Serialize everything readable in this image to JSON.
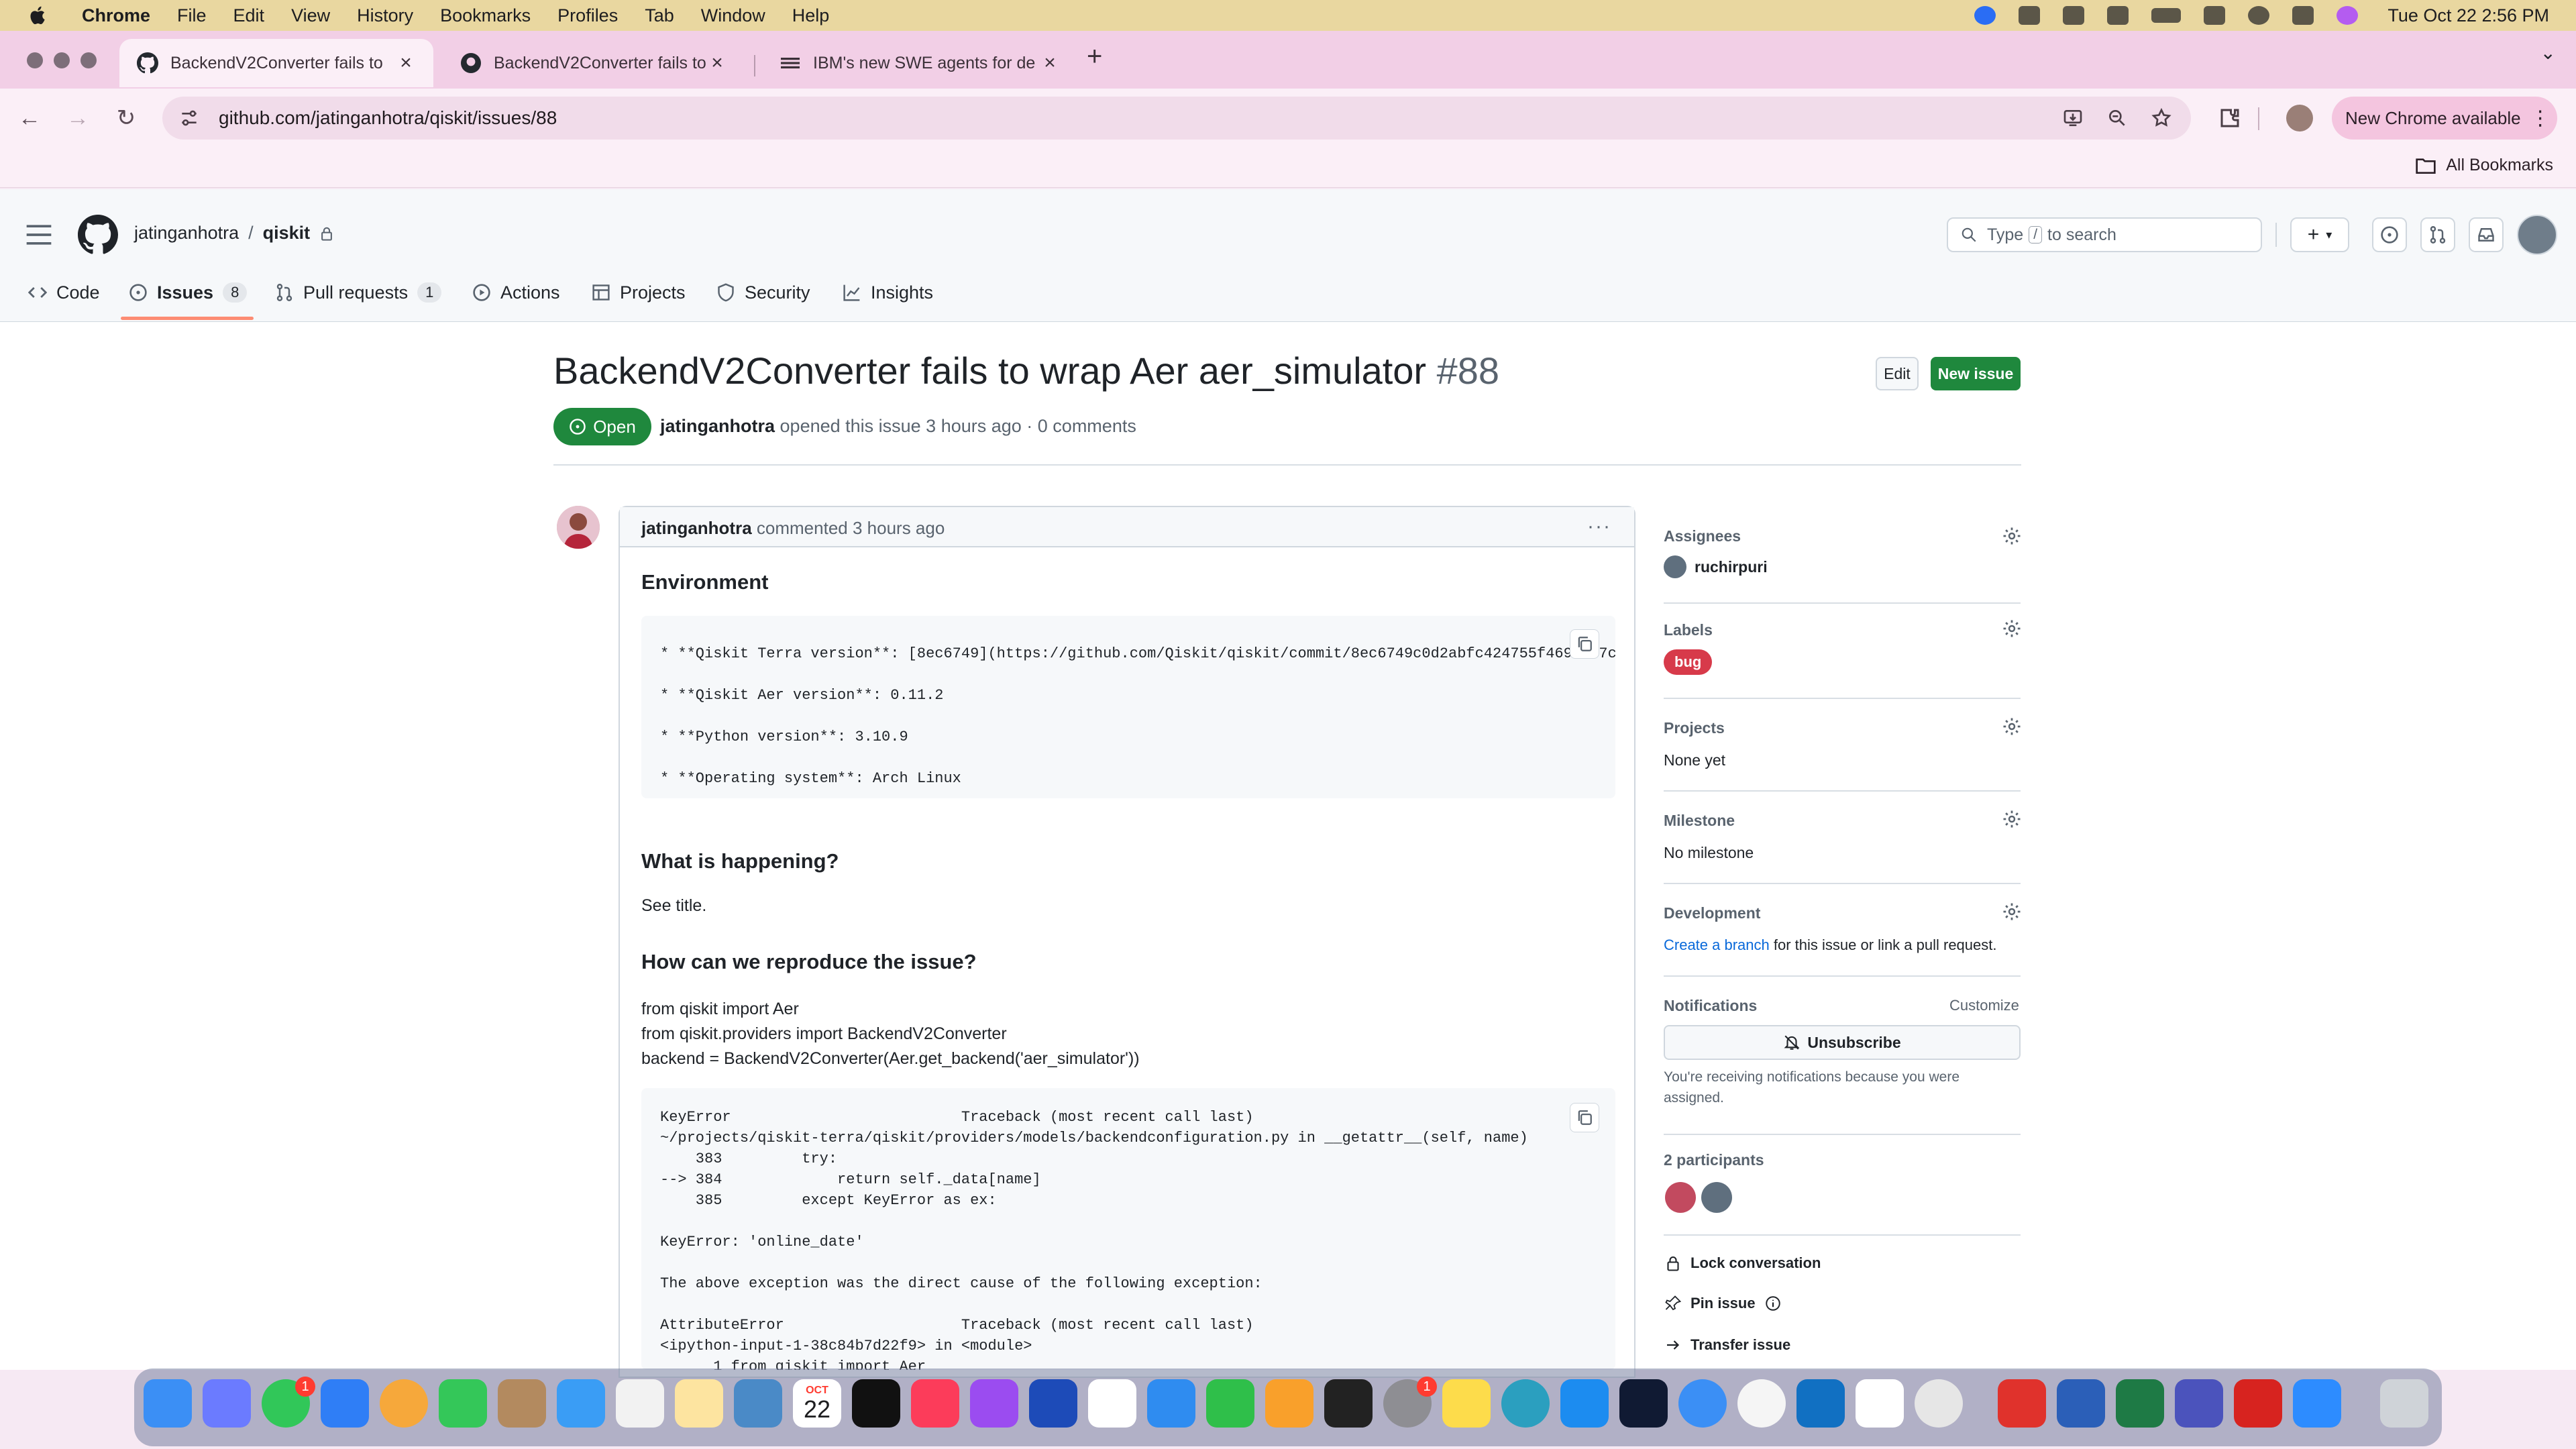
{
  "menubar": {
    "app": "Chrome",
    "items": [
      "File",
      "Edit",
      "View",
      "History",
      "Bookmarks",
      "Profiles",
      "Tab",
      "Window",
      "Help"
    ],
    "clock": "Tue Oct 22  2:56 PM"
  },
  "browser": {
    "tabs": [
      {
        "title": "BackendV2Converter fails to",
        "icon": "github-icon"
      },
      {
        "title": "BackendV2Converter fails to",
        "icon": "github-icon"
      },
      {
        "title": "IBM's new SWE agents for de",
        "icon": "ibm-icon"
      }
    ],
    "url": "github.com/jatinganhotra/qiskit/issues/88",
    "new_chrome": "New Chrome available",
    "all_bookmarks": "All Bookmarks"
  },
  "github": {
    "owner": "jatinganhotra",
    "sep": "/",
    "repo": "qiskit",
    "search_prefix": "Type",
    "search_key": "/",
    "search_suffix": "to search",
    "tabs": [
      {
        "label": "Code",
        "count": ""
      },
      {
        "label": "Issues",
        "count": "8"
      },
      {
        "label": "Pull requests",
        "count": "1"
      },
      {
        "label": "Actions",
        "count": ""
      },
      {
        "label": "Projects",
        "count": ""
      },
      {
        "label": "Security",
        "count": ""
      },
      {
        "label": "Insights",
        "count": ""
      }
    ]
  },
  "issue": {
    "title": "BackendV2Converter fails to wrap Aer aer_simulator",
    "number": "#88",
    "edit": "Edit",
    "new_issue": "New issue",
    "state": "Open",
    "author": "jatinganhotra",
    "opened_text": "opened this issue 3 hours ago · 0 comments"
  },
  "comment": {
    "author": "jatinganhotra",
    "time_text": "commented 3 hours ago",
    "env_heading": "Environment",
    "env_lines": [
      "* **Qiskit Terra version**: [8ec6749](https://github.com/Qiskit/qiskit/commit/8ec6749c0d2abfc424755f4698a 7c",
      "* **Qiskit Aer version**: 0.11.2",
      "* **Python version**: 3.10.9",
      "* **Operating system**: Arch Linux"
    ],
    "what_heading": "What is happening?",
    "what_text": "See title.",
    "repro_heading": "How can we reproduce the issue?",
    "repro_lines": [
      "from qiskit import Aer",
      "from qiskit.providers import BackendV2Converter",
      "backend = BackendV2Converter(Aer.get_backend('aer_simulator'))"
    ],
    "trace_lines": [
      "KeyError                          Traceback (most recent call last)",
      "~/projects/qiskit-terra/qiskit/providers/models/backendconfiguration.py in __getattr__(self, name)",
      "    383         try:",
      "--> 384             return self._data[name]",
      "    385         except KeyError as ex:",
      "",
      "KeyError: 'online_date'",
      "",
      "The above exception was the direct cause of the following exception:",
      "",
      "AttributeError                    Traceback (most recent call last)",
      "<ipython-input-1-38c84b7d22f9> in <module>",
      "      1 from qiskit import Aer"
    ]
  },
  "sidebar": {
    "assignees_label": "Assignees",
    "assignee": "ruchirpuri",
    "labels_label": "Labels",
    "label": "bug",
    "projects_label": "Projects",
    "projects_value": "None yet",
    "milestone_label": "Milestone",
    "milestone_value": "No milestone",
    "development_label": "Development",
    "create_branch": "Create a branch",
    "dev_rest": "for this issue or link a pull request.",
    "notifications_label": "Notifications",
    "customize": "Customize",
    "unsubscribe": "Unsubscribe",
    "notif_text": "You're receiving notifications because you were assigned.",
    "participants_label": "2 participants",
    "lock": "Lock conversation",
    "pin": "Pin issue",
    "transfer": "Transfer issue"
  },
  "dock": {
    "calendar_month": "OCT",
    "calendar_day": "22",
    "badge1": "1",
    "badge2": "1"
  },
  "colors": {
    "github_green": "#1f883d",
    "bug_red": "#d73a4a",
    "link_blue": "#0969da",
    "tab_underline": "#fd8c73"
  }
}
